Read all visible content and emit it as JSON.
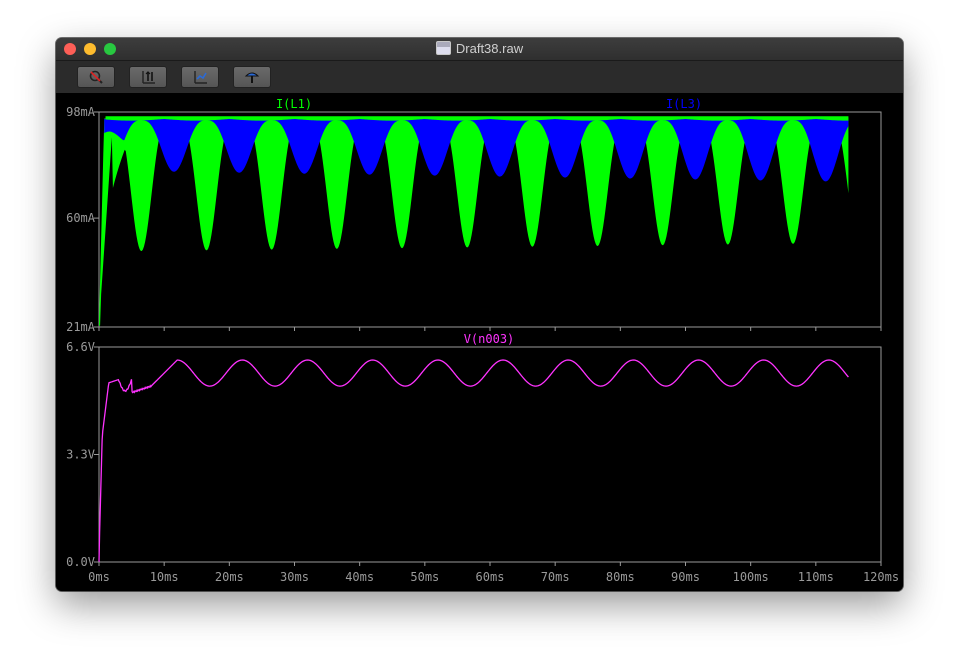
{
  "window": {
    "title": "Draft38.raw"
  },
  "toolbar": {
    "buttons": [
      {
        "icon": "zoom-cancel-icon"
      },
      {
        "icon": "autorange-icon"
      },
      {
        "icon": "zoom-fit-icon"
      },
      {
        "icon": "probe-icon"
      }
    ]
  },
  "colors": {
    "green": "#00ff00",
    "blue": "#0000ff",
    "magenta": "#ff33ff",
    "grid": "#9a9a9a"
  },
  "chart_data": [
    {
      "type": "area",
      "series": [
        {
          "name": "I(L1)",
          "color": "#00ff00"
        },
        {
          "name": "I(L3)",
          "color": "#0000ff"
        }
      ],
      "xlim": [
        0,
        120
      ],
      "ylim": [
        21,
        98
      ],
      "x_ticks": [
        "0ms",
        "10ms",
        "20ms",
        "30ms",
        "40ms",
        "50ms",
        "60ms",
        "70ms",
        "80ms",
        "90ms",
        "100ms",
        "110ms",
        "120ms"
      ],
      "y_ticks": [
        "98mA",
        "60mA",
        "21mA"
      ],
      "x_end": 115,
      "period_ms": 10,
      "I_L1_envelope": {
        "max_mA": 96,
        "min_mA_start": 48,
        "min_mA_end": 51
      },
      "I_L3_envelope": {
        "max_mA": 95,
        "min_mA_start": 77,
        "min_mA_end": 73
      }
    },
    {
      "type": "line",
      "series": [
        {
          "name": "V(n003)",
          "color": "#ff33ff"
        }
      ],
      "xlim": [
        0,
        120
      ],
      "ylim": [
        0.0,
        6.6
      ],
      "x_ticks": [
        "0ms",
        "10ms",
        "20ms",
        "30ms",
        "40ms",
        "50ms",
        "60ms",
        "70ms",
        "80ms",
        "90ms",
        "100ms",
        "110ms",
        "120ms"
      ],
      "y_ticks": [
        "6.6V",
        "3.3V",
        "0.0V"
      ],
      "x_end": 115,
      "ripple": {
        "mean_V": 5.8,
        "amplitude_V": 0.4,
        "period_ms": 10
      }
    }
  ]
}
